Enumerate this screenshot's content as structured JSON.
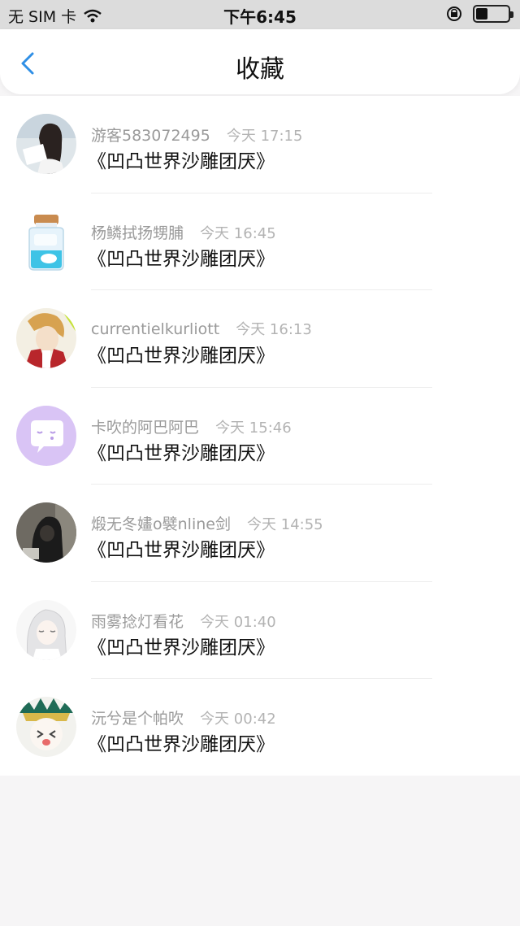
{
  "status_bar": {
    "carrier": "无 SIM 卡",
    "time": "下午6:45"
  },
  "nav": {
    "title": "收藏"
  },
  "items": [
    {
      "name": "游客583072495",
      "time": "今天 17:15",
      "title": "《凹凸世界沙雕团厌》"
    },
    {
      "name": "杨鳞拭扬甥脯",
      "time": "今天 16:45",
      "title": "《凹凸世界沙雕团厌》"
    },
    {
      "name": "currentielkurliott",
      "time": "今天 16:13",
      "title": "《凹凸世界沙雕团厌》"
    },
    {
      "name": "卡吹的阿巴阿巴",
      "time": "今天 15:46",
      "title": "《凹凸世界沙雕团厌》"
    },
    {
      "name": "煅无冬嫿o襞nline剑",
      "time": "今天 14:55",
      "title": "《凹凸世界沙雕团厌》"
    },
    {
      "name": "雨雾捻灯看花",
      "time": "今天 01:40",
      "title": "《凹凸世界沙雕团厌》"
    },
    {
      "name": "沅兮是个帕吹",
      "time": "今天 00:42",
      "title": "《凹凸世界沙雕团厌》"
    }
  ],
  "colors": {
    "accent": "#2f8fe6",
    "background": "#f6f5f6"
  }
}
